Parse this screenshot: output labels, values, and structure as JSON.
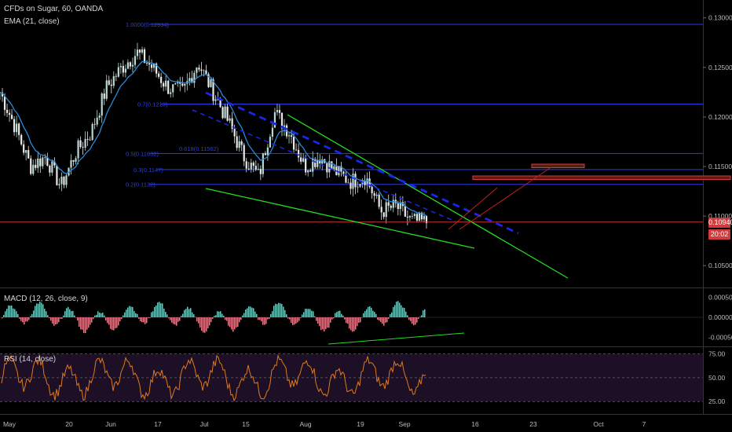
{
  "header": {
    "title": "CFDs on Sugar, 60, OANDA",
    "indicator": "EMA (21, close)"
  },
  "price_panel": {
    "y_ticks": [
      "0.13000",
      "0.12500",
      "0.12000",
      "0.11500",
      "0.11000",
      "0.10500"
    ],
    "last_price": "0.10940",
    "countdown": "20:02",
    "fib_labels": [
      "1.0000(0.12934)",
      "0.7(0.1213)",
      "0.5(0.11632)",
      "0.3(0.1147)",
      "0.2(0.1132)",
      "0.618(0.11562)"
    ]
  },
  "macd_panel": {
    "label": "MACD (12, 26, close, 9)",
    "y_ticks": [
      "0.00050",
      "0.00000",
      "-0.00050"
    ]
  },
  "rsi_panel": {
    "label": "RSI (14, close)",
    "y_ticks": [
      "75.00",
      "50.00",
      "25.00"
    ]
  },
  "time_axis": {
    "labels": [
      "May",
      "20",
      "Jun",
      "17",
      "Jul",
      "15",
      "Aug",
      "19",
      "Sep",
      "16",
      "23",
      "Oct",
      "7"
    ]
  },
  "colors": {
    "background": "#000000",
    "candle_up": "#b9d8d4",
    "candle_down": "#e8e8e8",
    "ema": "#2a8bd8",
    "fib_line": "#2a3de8",
    "trend_green": "#22dd22",
    "dashed_trend": "#1a26e8",
    "price_line": "#d23b3b",
    "macd_up": "#6ec7bd",
    "macd_down": "#e57c8a",
    "rsi_line": "#e07a1a",
    "rsi_band": "#1d0f26"
  },
  "chart_data": {
    "type": "line",
    "title": "CFDs on Sugar, 60, OANDA",
    "xlabel": "",
    "ylabel": "",
    "ylim": [
      0.1028,
      0.1318
    ],
    "close_path": [
      {
        "x": "May",
        "y": 0.1225
      },
      {
        "x": "8 May",
        "y": 0.119
      },
      {
        "x": "13 May",
        "y": 0.115
      },
      {
        "x": "20",
        "y": 0.116
      },
      {
        "x": "23 May",
        "y": 0.113
      },
      {
        "x": "27 May",
        "y": 0.1165
      },
      {
        "x": "Jun",
        "y": 0.1185
      },
      {
        "x": "7 Jun",
        "y": 0.123
      },
      {
        "x": "13 Jun",
        "y": 0.125
      },
      {
        "x": "17",
        "y": 0.1265
      },
      {
        "x": "20 Jun",
        "y": 0.125
      },
      {
        "x": "26 Jun",
        "y": 0.123
      },
      {
        "x": "Jul",
        "y": 0.1225
      },
      {
        "x": "5 Jul",
        "y": 0.1255
      },
      {
        "x": "10 Jul",
        "y": 0.1225
      },
      {
        "x": "15",
        "y": 0.1195
      },
      {
        "x": "19 Jul",
        "y": 0.116
      },
      {
        "x": "24 Jul",
        "y": 0.114
      },
      {
        "x": "29 Jul",
        "y": 0.1205
      },
      {
        "x": "Aug",
        "y": 0.1185
      },
      {
        "x": "7 Aug",
        "y": 0.115
      },
      {
        "x": "12 Aug",
        "y": 0.116
      },
      {
        "x": "16 Aug",
        "y": 0.1145
      },
      {
        "x": "19",
        "y": 0.1135
      },
      {
        "x": "23 Aug",
        "y": 0.114
      },
      {
        "x": "28 Aug",
        "y": 0.1105
      },
      {
        "x": "Sep",
        "y": 0.111
      },
      {
        "x": "4 Sep",
        "y": 0.1095
      },
      {
        "x": "6 Sep",
        "y": 0.1094
      }
    ],
    "last_price": 0.1094,
    "fib_levels": [
      0.12934,
      0.1213,
      0.11632,
      0.1147,
      0.1132
    ],
    "macd_range": [
      -0.00065,
      0.00065
    ],
    "rsi_range": [
      12,
      82
    ],
    "rsi_bands": [
      75,
      50,
      25
    ]
  }
}
